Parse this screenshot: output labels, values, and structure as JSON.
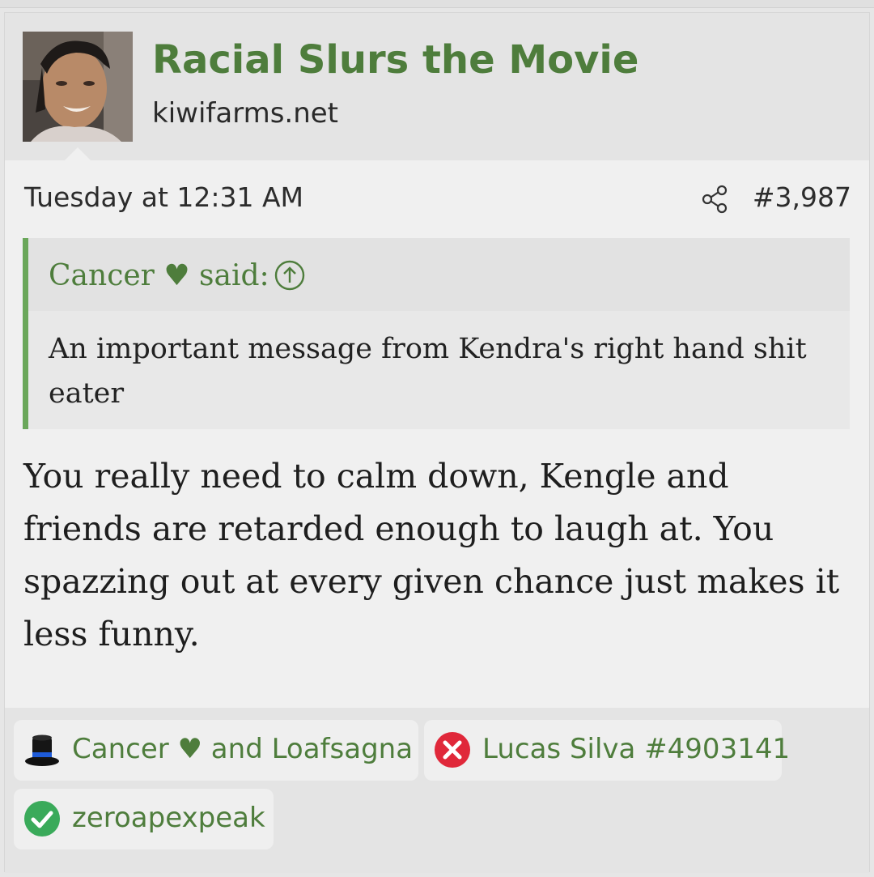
{
  "thread": {
    "title": "Racial Slurs the Movie",
    "site": "kiwifarms.net"
  },
  "post": {
    "date": "Tuesday at 12:31 AM",
    "number": "#3,987",
    "share_icon": "share-icon"
  },
  "quote": {
    "author_line": "Cancer ♥ said:",
    "jump_icon": "arrow-up-circle-icon",
    "text": "An important message from Kendra's right hand shit eater"
  },
  "message": {
    "text": "You really need to calm down, Kengle and friends are retarded enough to laugh at. You spazzing out at every given chance just makes it less funny."
  },
  "reactions": [
    {
      "icon": "top-hat-icon",
      "label": "Cancer ♥ and Loafsagna",
      "color": "#1a1a1a"
    },
    {
      "icon": "red-x-icon",
      "label": "Lucas Silva #4903141",
      "color": "#e0283a"
    },
    {
      "icon": "green-check-icon",
      "label": "zeroapexpeak",
      "color": "#3aaa5a"
    }
  ],
  "colors": {
    "accent_green": "#4e7d3c",
    "quote_bar": "#6aa75a"
  }
}
